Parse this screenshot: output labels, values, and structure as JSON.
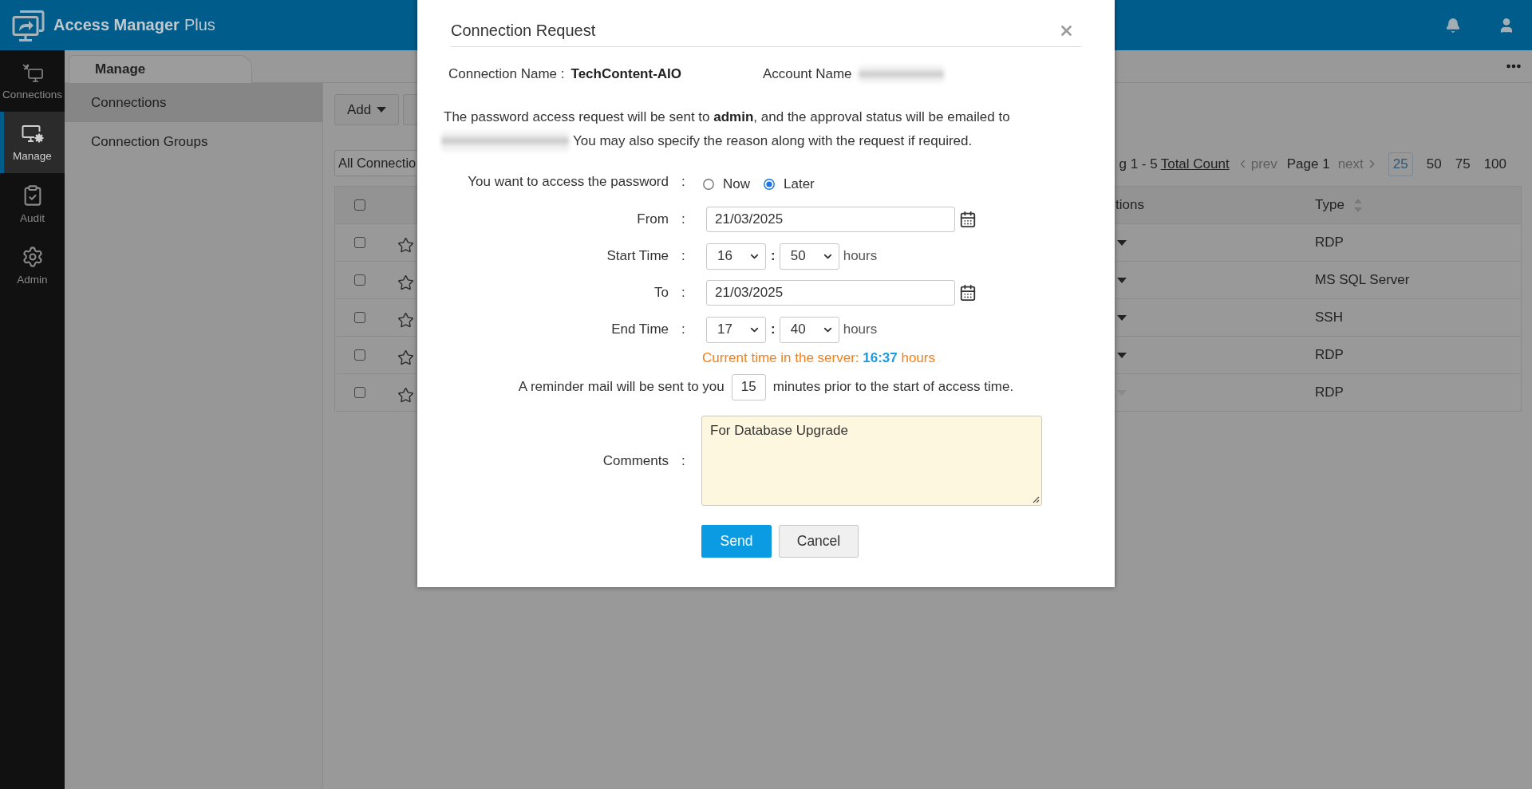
{
  "header": {
    "brand": "Access Manager",
    "edition": "Plus"
  },
  "nav": [
    {
      "label": "Connections",
      "selected": false
    },
    {
      "label": "Manage",
      "selected": true
    },
    {
      "label": "Audit",
      "selected": false
    },
    {
      "label": "Admin",
      "selected": false
    }
  ],
  "tabs": [
    {
      "label": "Manage",
      "selected": true
    }
  ],
  "subnav": [
    {
      "label": "Connections",
      "selected": true
    },
    {
      "label": "Connection Groups",
      "selected": false
    }
  ],
  "toolbar": {
    "add_button": "Add"
  },
  "filter": {
    "value": "All Connectio"
  },
  "pagination": {
    "range": "g 1 - 5",
    "total_link": "Total Count",
    "prev": {
      "label": "prev",
      "disabled": true
    },
    "page": "Page 1",
    "next": {
      "label": "next",
      "disabled": true
    },
    "page_sizes": [
      {
        "label": "25",
        "selected": true
      },
      {
        "label": "50",
        "selected": false
      },
      {
        "label": "75",
        "selected": false
      },
      {
        "label": "100",
        "selected": false
      }
    ]
  },
  "table": {
    "all_checked": false,
    "columns": [
      {
        "label": "tions",
        "sortable": false
      },
      {
        "label": "Type",
        "sortable": true
      }
    ],
    "rows": [
      {
        "checked": false,
        "favorite": false,
        "disabled": false,
        "type": "RDP"
      },
      {
        "checked": false,
        "favorite": false,
        "disabled": false,
        "type": "MS SQL Server"
      },
      {
        "checked": false,
        "favorite": false,
        "disabled": false,
        "type": "SSH"
      },
      {
        "checked": false,
        "favorite": false,
        "disabled": false,
        "type": "RDP"
      },
      {
        "checked": false,
        "favorite": false,
        "disabled": true,
        "type": "RDP"
      }
    ]
  },
  "dialog": {
    "title": "Connection Request",
    "connection": {
      "label": "Connection Name :",
      "value": "TechContent-AIO"
    },
    "account": {
      "label": "Account Name"
    },
    "notice": "The password access request will be sent to **admin**, and the approval status will be emailed to",
    "notice_continued": "You may also specify the reason along with the request if required.",
    "fields": [
      {
        "kind": "radio",
        "label": "You want to access the password",
        "colon": ":",
        "options": [
          {
            "label": "Now",
            "selected": false
          },
          {
            "label": "Later",
            "selected": true
          }
        ]
      },
      {
        "kind": "date",
        "label": "From",
        "colon": ":",
        "value": "21/03/2025"
      },
      {
        "kind": "time",
        "label": "Start Time",
        "colon": ":",
        "hour": "16",
        "separator": ":",
        "minute": "50",
        "unit": "hours"
      },
      {
        "kind": "date",
        "label": "To",
        "colon": ":",
        "value": "21/03/2025"
      },
      {
        "kind": "time",
        "label": "End Time",
        "colon": ":",
        "hour": "17",
        "separator": ":",
        "minute": "40",
        "unit": "hours"
      }
    ],
    "server_time": "Current time in the server: **16:37** hours",
    "reminder": {
      "before": "A reminder mail will be sent to you",
      "value": "15",
      "after": "minutes prior to the start of access time."
    },
    "comments": {
      "label": "Comments",
      "colon": ":",
      "value": "For Database Upgrade"
    },
    "buttons": [
      {
        "label": "Send",
        "kind": "primary"
      },
      {
        "label": "Cancel",
        "kind": "secondary"
      }
    ]
  }
}
